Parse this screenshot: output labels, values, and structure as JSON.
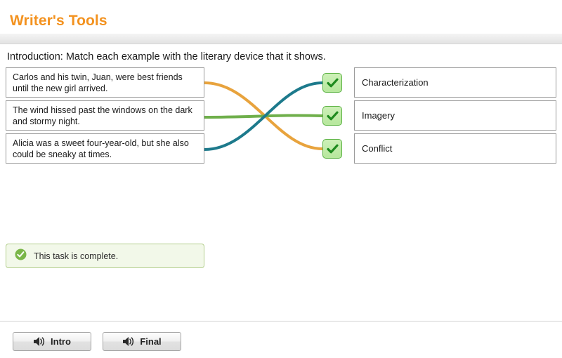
{
  "header": {
    "title": "Writer's Tools",
    "title_color": "#F3921F"
  },
  "instruction": "Introduction: Match each example with the literary device that it shows.",
  "matching": {
    "prompts": [
      {
        "text": "Carlos and his twin, Juan, were best friends until the new girl arrived."
      },
      {
        "text": "The wind hissed past the windows on the dark and stormy night."
      },
      {
        "text": "Alicia was a sweet four-year-old, but she also could be sneaky at times."
      }
    ],
    "answers": [
      {
        "label": "Characterization"
      },
      {
        "label": "Imagery"
      },
      {
        "label": "Conflict"
      }
    ],
    "connections": [
      {
        "from_prompt": 0,
        "to_answer": 2,
        "color": "#E8A33D"
      },
      {
        "from_prompt": 1,
        "to_answer": 1,
        "color": "#6FAF4B"
      },
      {
        "from_prompt": 2,
        "to_answer": 0,
        "color": "#1D7A8C"
      }
    ],
    "badge_state": [
      "correct",
      "correct",
      "correct"
    ],
    "badge_colors": {
      "fill_top": "#CDF0B8",
      "fill_bottom": "#B6E79C",
      "border": "#5EB346",
      "check": "#1E8A1E"
    }
  },
  "completion": {
    "message": "This task is complete.",
    "icon_color": "#7AB648",
    "background": "#F2F8E9",
    "border": "#B4CF8E"
  },
  "footer": {
    "buttons": [
      {
        "label": "Intro",
        "icon": "speaker-icon"
      },
      {
        "label": "Final",
        "icon": "speaker-icon"
      }
    ]
  }
}
